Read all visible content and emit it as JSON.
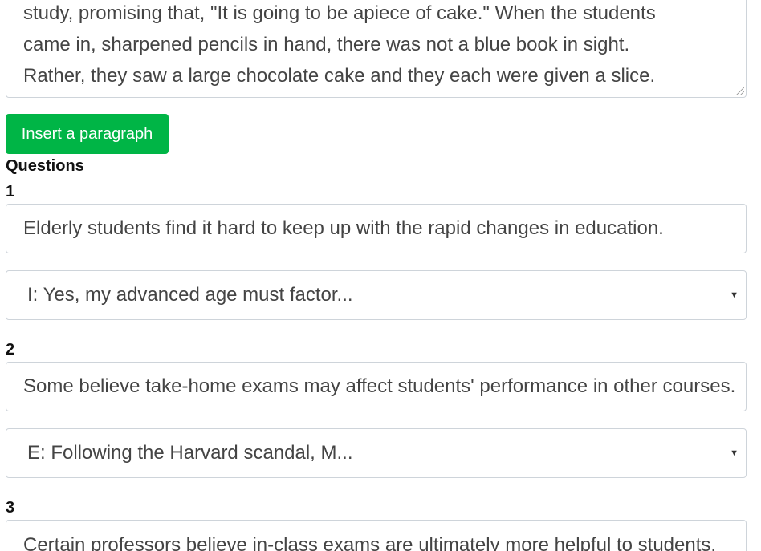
{
  "passage": {
    "lines": [
      "study, promising that, \"It is going to be apiece of cake.\" When the students",
      "came in, sharpened pencils in hand, there was not a blue book in sight.",
      "Rather, they saw a large chocolate cake and they each were given a slice."
    ]
  },
  "insert_button_label": "Insert a paragraph",
  "questions_heading": "Questions",
  "questions": [
    {
      "number": "1",
      "text": "Elderly students find it hard to keep up with the rapid changes in education.",
      "selected": "I: Yes, my advanced age must factor..."
    },
    {
      "number": "2",
      "text": "Some believe take-home exams may affect students' performance in other courses.",
      "selected": "E: Following the Harvard scandal, M..."
    },
    {
      "number": "3",
      "text": "Certain professors believe in-class exams are ultimately more helpful to students."
    }
  ]
}
